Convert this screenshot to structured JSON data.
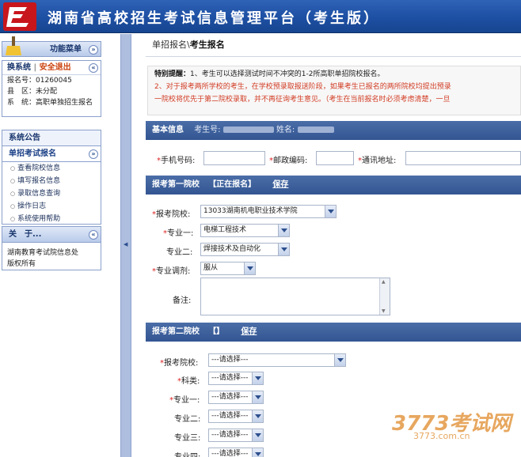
{
  "header": {
    "title": "湖南省高校招生考试信息管理平台（考生版）"
  },
  "sidebar": {
    "menu_panel": {
      "title": "功能菜单",
      "toggle": "»"
    },
    "user_panel": {
      "switch": "换系统",
      "logout": "安全退出",
      "toggle": "«",
      "exam_no_label": "报名号：",
      "exam_no": "01260045",
      "county_label": "县　区：",
      "county": "未分配",
      "system_label": "系　统：",
      "system": "高职单独招生报名"
    },
    "notice_panel": {
      "title": "系统公告"
    },
    "reg_panel": {
      "title": "单招考试报名",
      "toggle": "»",
      "items": [
        "查看院校信息",
        "填写报名信息",
        "录取信息查询",
        "操作日志",
        "系统使用帮助"
      ]
    },
    "about_panel": {
      "title": "关　于...",
      "toggle": "«",
      "text1": "湖南教育考试院信息处",
      "text2": "版权所有"
    }
  },
  "main": {
    "breadcrumb_parent": "单招报名\\",
    "breadcrumb_current": "考生报名",
    "notice": {
      "label": "特别提醒：",
      "line1": "1、考生可以选择测试时间不冲突的1-2所高职单招院校报名。",
      "line2": "2、对于报考两所学校的考生，在学校预录取报送阶段，如果考生已报名的两所院校均提出预录",
      "line3": "一院校将优先于第二院校录取，并不再征询考生意见。（考生在当前报名时必须考虑清楚，一旦"
    },
    "basic": {
      "title": "基本信息",
      "exam_no_label": "考生号:",
      "name_label": "姓名:",
      "phone_label": "手机号码:",
      "zip_label": "邮政编码:",
      "address_label": "通讯地址:",
      "phone": "",
      "zip": "",
      "address": ""
    },
    "first": {
      "title": "报考第一院校",
      "status": "【正在报名】",
      "save": "保存",
      "school_label": "报考院校:",
      "school": "13033湖南机电职业技术学院",
      "major1_label": "专业一:",
      "major1": "电梯工程技术",
      "major2_label": "专业二:",
      "major2": "焊接技术及自动化",
      "adjust_label": "专业调剂:",
      "adjust": "服从",
      "remark_label": "备注:"
    },
    "second": {
      "title": "报考第二院校",
      "status": "【】",
      "save": "保存",
      "school_label": "报考院校:",
      "school": "---请选择---",
      "subject_label": "科类:",
      "subject": "---请选择---",
      "major1_label": "专业一:",
      "major1": "---请选择---",
      "major2_label": "专业二:",
      "major2": "---请选择---",
      "major3_label": "专业三:",
      "major3": "---请选择---",
      "major4_label": "专业四:",
      "major4": "---请选择---"
    }
  },
  "watermark": {
    "brand": "3773考试网",
    "url": "3773.com.cn"
  },
  "colors": {
    "header": "#1d4fa3",
    "section_bar": "#3d5f9c",
    "required_star": "#dd2222",
    "notice_red": "#d23b23"
  }
}
